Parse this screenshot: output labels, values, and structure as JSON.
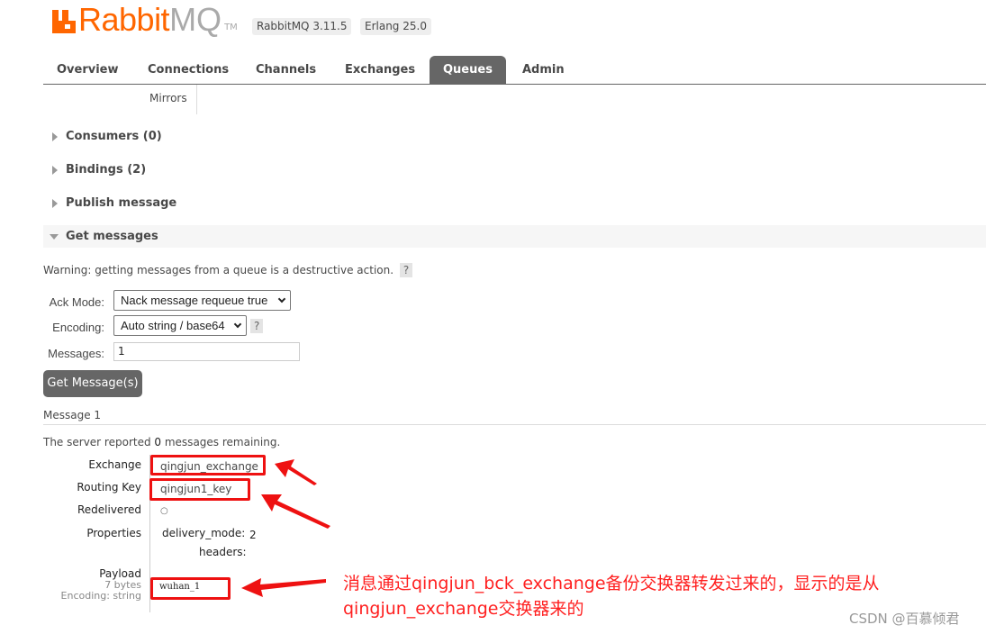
{
  "header": {
    "logo_primary": "Rabbit",
    "logo_secondary": "MQ",
    "logo_tm": "TM",
    "version_badge": "RabbitMQ 3.11.5",
    "erlang_badge": "Erlang 25.0"
  },
  "nav": {
    "tabs": [
      {
        "label": "Overview",
        "active": false
      },
      {
        "label": "Connections",
        "active": false
      },
      {
        "label": "Channels",
        "active": false
      },
      {
        "label": "Exchanges",
        "active": false
      },
      {
        "label": "Queues",
        "active": true
      },
      {
        "label": "Admin",
        "active": false
      }
    ],
    "subnav": "Mirrors"
  },
  "sections": [
    {
      "label": "Consumers (0)",
      "expanded": false
    },
    {
      "label": "Bindings (2)",
      "expanded": false
    },
    {
      "label": "Publish message",
      "expanded": false
    },
    {
      "label": "Get messages",
      "expanded": true
    }
  ],
  "get_messages": {
    "warning": "Warning: getting messages from a queue is a destructive action.",
    "help": "?",
    "ack_mode_label": "Ack Mode:",
    "ack_mode_value": "Nack message requeue true",
    "encoding_label": "Encoding:",
    "encoding_value": "Auto string / base64",
    "messages_label": "Messages:",
    "messages_value": "1",
    "button": "Get Message(s)"
  },
  "result": {
    "title": "Message 1",
    "server_note_prefix": "The server reported ",
    "server_note_count": "0",
    "server_note_suffix": " messages remaining.",
    "exchange_label": "Exchange",
    "exchange_value": "qingjun_exchange",
    "routing_key_label": "Routing Key",
    "routing_key_value": "qingjun1_key",
    "redelivered_label": "Redelivered",
    "redelivered_value": "○",
    "properties_label": "Properties",
    "delivery_mode_label": "delivery_mode:",
    "delivery_mode_value": "2",
    "headers_label": "headers:",
    "payload_label": "Payload",
    "payload_size": "7 bytes",
    "payload_encoding": "Encoding: string",
    "payload_value": "wuhan_1"
  },
  "annotation": {
    "line1": "消息通过qingjun_bck_exchange备份交换器转发过来的，显示的是从",
    "line2": "qingjun_exchange交换器来的",
    "color": "#ff2020"
  },
  "watermark": "CSDN @百慕倾君"
}
